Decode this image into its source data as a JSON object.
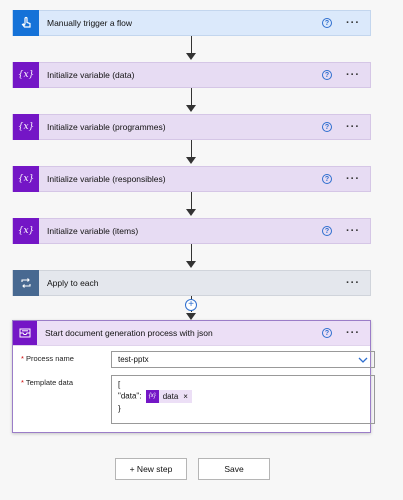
{
  "steps": [
    {
      "title": "Manually trigger a flow",
      "icon": "hand-touch-icon",
      "type": "trigger",
      "help": true
    },
    {
      "title": "Initialize variable (data)",
      "icon": "variable-icon",
      "type": "var",
      "help": true
    },
    {
      "title": "Initialize variable (programmes)",
      "icon": "variable-icon",
      "type": "var",
      "help": true
    },
    {
      "title": "Initialize variable (responsibles)",
      "icon": "variable-icon",
      "type": "var",
      "help": true
    },
    {
      "title": "Initialize variable (items)",
      "icon": "variable-icon",
      "type": "var",
      "help": true
    },
    {
      "title": "Apply to each",
      "icon": "loop-icon",
      "type": "apply",
      "help": false
    }
  ],
  "help_glyph": "?",
  "more_glyph": "···",
  "variable_glyph": "{x}",
  "add_glyph": "+",
  "action": {
    "title": "Start document generation process with json",
    "icon": "document-tray-icon",
    "process_label": "Process name",
    "process_value": "test-pptx",
    "template_label": "Template data",
    "json_open": "[",
    "json_key": "\"data\":",
    "token_label": "data",
    "token_icon_glyph": "{x}",
    "token_remove": "×",
    "json_close": "}",
    "required_mark": "*"
  },
  "buttons": {
    "new_step": "+ New step",
    "save": "Save"
  },
  "colors": {
    "trigger": "#dbe9fb",
    "variable": "#e7dcf3",
    "apply": "#e4e7ed",
    "accent_purple": "#7416c6",
    "accent_blue": "#1572d8"
  }
}
